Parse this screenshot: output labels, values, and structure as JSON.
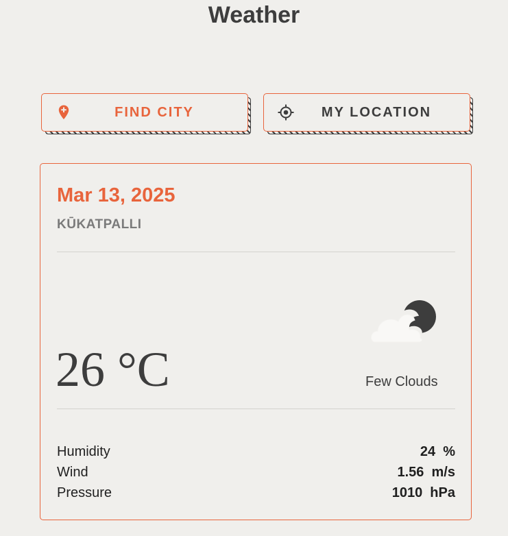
{
  "app": {
    "title": "Weather"
  },
  "buttons": {
    "find_city_label": "FIND CITY",
    "find_city_icon": "map-pin-plus-icon",
    "my_location_label": "MY LOCATION",
    "my_location_icon": "crosshair-icon"
  },
  "weather": {
    "date": "Mar 13, 2025",
    "city": "KŪKATPALLI",
    "temperature": "26 °C",
    "condition": "Few Clouds",
    "condition_icon": "few-clouds-night-icon"
  },
  "stats": [
    {
      "name": "Humidity",
      "value": "24  %"
    },
    {
      "name": "Wind",
      "value": "1.56  m/s"
    },
    {
      "name": "Pressure",
      "value": "1010  hPa"
    }
  ],
  "colors": {
    "accent": "#e8643c",
    "text": "#3d3d3d",
    "background": "#f0efec"
  }
}
